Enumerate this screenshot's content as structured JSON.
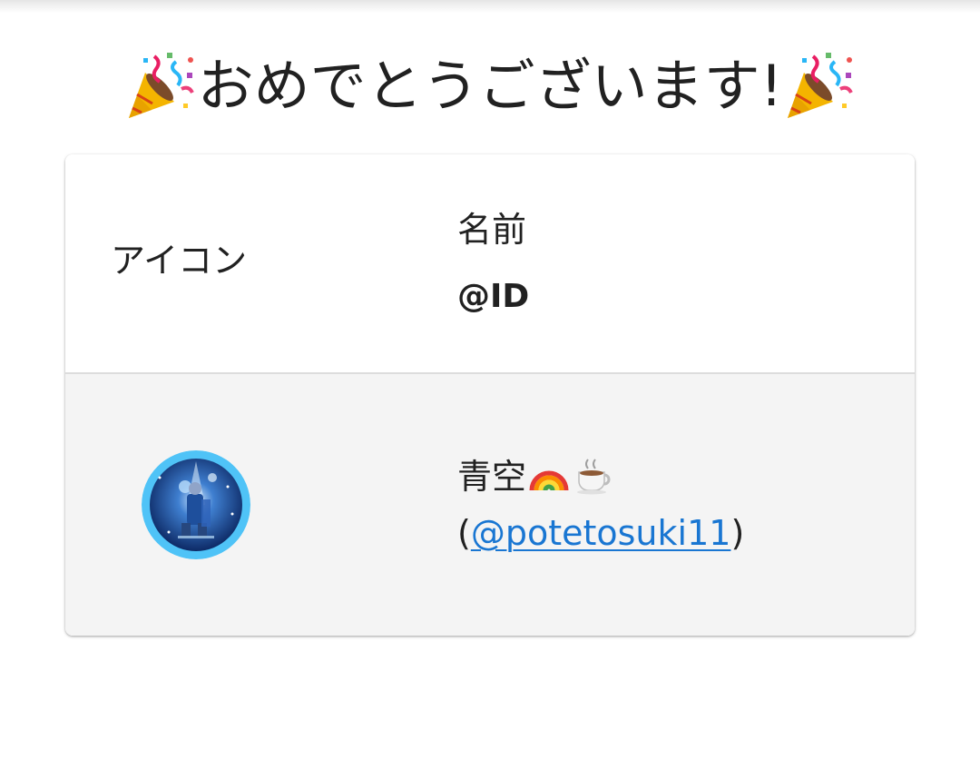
{
  "title": {
    "text": "おめでとうございます!",
    "left_icon": "party-popper-icon",
    "right_icon": "party-popper-icon"
  },
  "table": {
    "header": {
      "icon_label": "アイコン",
      "name_label": "名前",
      "id_label": "@ID"
    },
    "rows": [
      {
        "avatar": "user-avatar",
        "name": "青空",
        "name_emojis": [
          "rainbow-icon",
          "hot-beverage-icon"
        ],
        "id_open": "(",
        "id_text": "@potetosuki11",
        "id_close": ")"
      }
    ]
  },
  "colors": {
    "link": "#1976d2",
    "row_background": "#f4f4f4",
    "text": "#212121",
    "avatar_ring": "#4fc3f7"
  }
}
